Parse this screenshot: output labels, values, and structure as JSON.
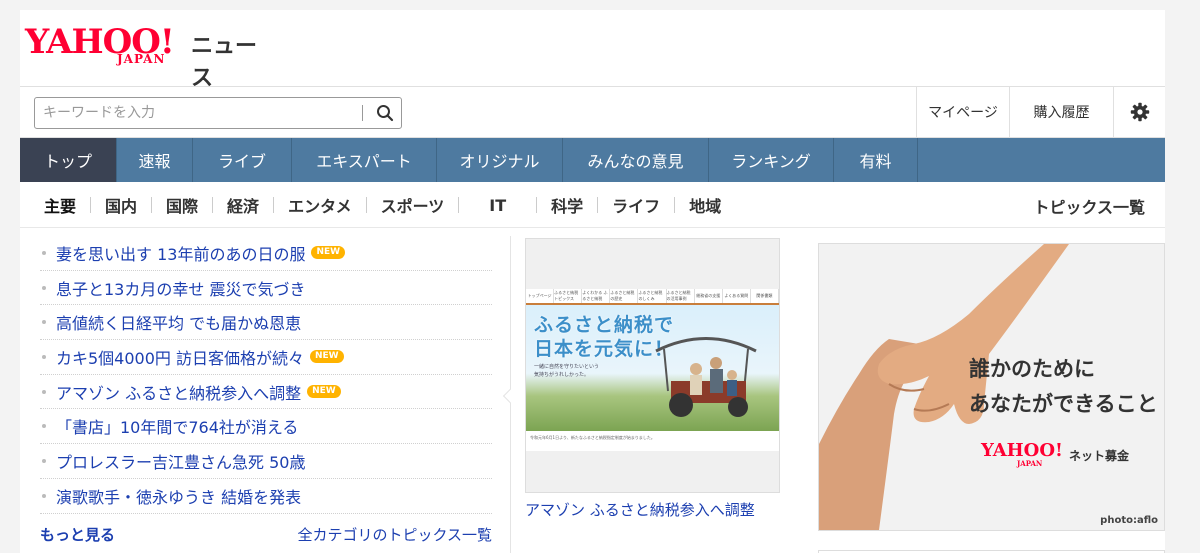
{
  "header": {
    "logo_yahoo": "YAHOO!",
    "logo_japan": "JAPAN",
    "logo_service": "ニュース"
  },
  "search": {
    "placeholder": "キーワードを入力",
    "value": ""
  },
  "header_links": {
    "mypage": "マイページ",
    "history": "購入履歴",
    "settings_icon": "gear-icon"
  },
  "nav": {
    "items": [
      {
        "label": "トップ",
        "active": true
      },
      {
        "label": "速報"
      },
      {
        "label": "ライブ"
      },
      {
        "label": "エキスパート"
      },
      {
        "label": "オリジナル"
      },
      {
        "label": "みんなの意見"
      },
      {
        "label": "ランキング"
      },
      {
        "label": "有料"
      }
    ]
  },
  "subnav": {
    "items": [
      "主要",
      "国内",
      "国際",
      "経済",
      "エンタメ",
      "スポーツ",
      "IT",
      "科学",
      "ライフ",
      "地域"
    ],
    "topics_link": "トピックス一覧"
  },
  "headlines": {
    "items": [
      {
        "text": "妻を思い出す 13年前のあの日の服",
        "new": "NEW"
      },
      {
        "text": "息子と13カ月の幸せ 震災で気づき",
        "new": ""
      },
      {
        "text": "高値続く日経平均 でも届かぬ恩恵",
        "new": ""
      },
      {
        "text": "カキ5個4000円 訪日客価格が続々",
        "new": "NEW"
      },
      {
        "text": "アマゾン ふるさと納税参入へ調整",
        "new": "NEW"
      },
      {
        "text": "「書店」10年間で764社が消える",
        "new": ""
      },
      {
        "text": "プロレスラー吉江豊さん急死 50歳",
        "new": ""
      },
      {
        "text": "演歌歌手・徳永ゆうき 結婚を発表",
        "new": ""
      }
    ],
    "more": "もっと見る",
    "all_topics": "全カテゴリのトピックス一覧"
  },
  "pickup": {
    "caption": "アマゾン ふるさと納税参入へ調整",
    "image_title_line1": "ふるさと納税で",
    "image_title_line2": "日本を元気に！",
    "image_sub_line1": "一緒に自然を守りたいという",
    "image_sub_line2": "気持ちがうれしかった。",
    "image_tabs": [
      "トップページ",
      "ふるさと納税トピックス",
      "よくわかる ふるさと納税",
      "ふるさと納税の歴史",
      "ふるさと納税のしくみ",
      "ふるさと納税の活用事例",
      "総務省の支援",
      "よくある質問",
      "関係書類"
    ],
    "image_footer": "令和元年6月1日より、新たなふるさと納税指定制度が始まりました。"
  },
  "ad": {
    "line1": "誰かのために",
    "line2": "あなたができること",
    "logo_yahoo": "YAHOO!",
    "logo_japan": "JAPAN",
    "service": "ネット募金",
    "credit": "photo:aflo"
  }
}
